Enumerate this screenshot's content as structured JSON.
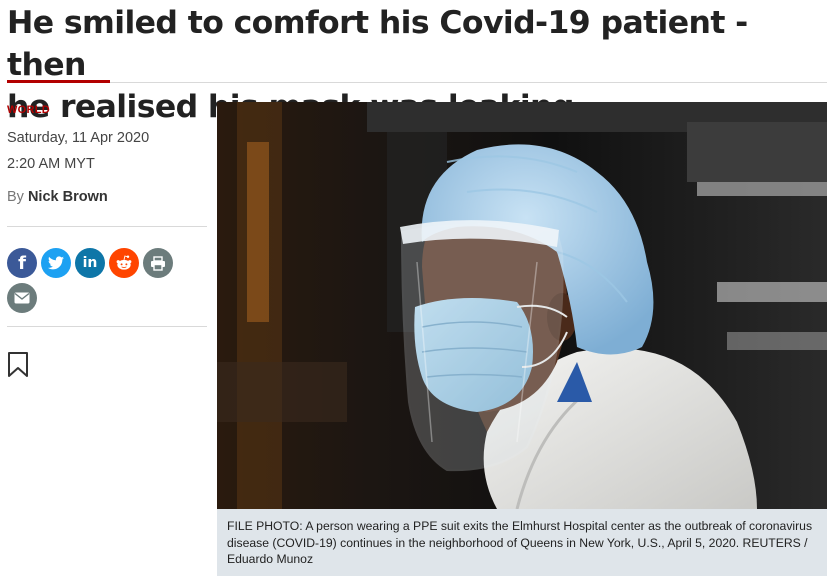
{
  "article": {
    "headline_line1": "He smiled to comfort his Covid-19 patient - then",
    "headline_line2": "he realised his mask was leaking",
    "category": "WORLD",
    "date": "Saturday, 11 Apr 2020",
    "time": "2:20 AM MYT",
    "byline_prefix": "By",
    "author": "Nick Brown"
  },
  "share": {
    "buttons": [
      {
        "name": "facebook",
        "icon": "facebook-icon",
        "glyph": "f",
        "color": "#3b5998"
      },
      {
        "name": "twitter",
        "icon": "twitter-icon",
        "color": "#1da1f2"
      },
      {
        "name": "linkedin",
        "icon": "linkedin-icon",
        "glyph": "in",
        "color": "#0e76a8"
      },
      {
        "name": "reddit",
        "icon": "reddit-icon",
        "color": "#ff4500"
      },
      {
        "name": "print",
        "icon": "print-icon",
        "color": "#6c7c7c"
      },
      {
        "name": "email",
        "icon": "email-icon",
        "color": "#6c7c7c"
      }
    ],
    "bookmark_icon": "bookmark-icon"
  },
  "photo": {
    "caption": "FILE PHOTO: A person wearing a PPE suit exits the Elmhurst Hospital center as the outbreak of coronavirus disease (COVID-19) continues in the neighborhood of Queens in New York, U.S., April 5, 2020. REUTERS / Eduardo Munoz"
  },
  "colors": {
    "accent": "#b30000",
    "caption_bg": "#dfe5ea"
  }
}
